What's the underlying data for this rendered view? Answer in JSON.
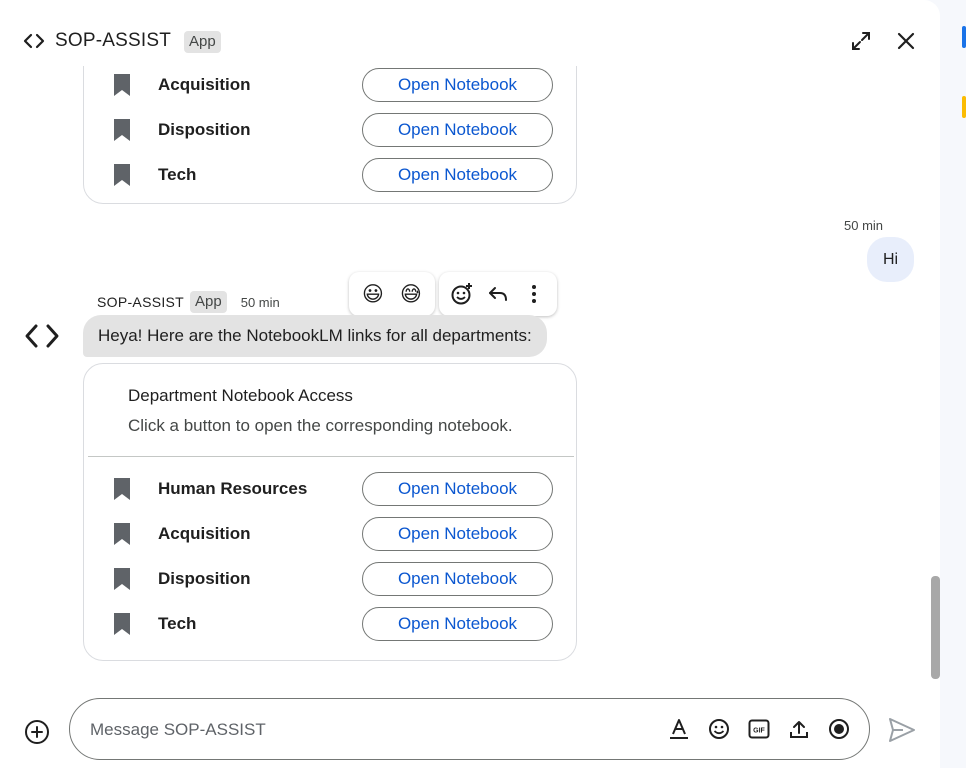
{
  "header": {
    "title": "SOP-ASSIST",
    "badge": "App",
    "icons": {
      "logo": "code-brackets-icon",
      "expand": "expand-icon",
      "close": "close-icon"
    }
  },
  "previous_card": {
    "rows": [
      {
        "label": "Acquisition",
        "button": "Open Notebook"
      },
      {
        "label": "Disposition",
        "button": "Open Notebook"
      },
      {
        "label": "Tech",
        "button": "Open Notebook"
      }
    ]
  },
  "user_message": {
    "time": "50 min",
    "text": "Hi"
  },
  "bot_message": {
    "sender": "SOP-ASSIST",
    "badge": "App",
    "time": "50 min",
    "text": "Heya! Here are the NotebookLM links for all departments:",
    "reactions": [
      "😃",
      "😅"
    ],
    "card": {
      "title": "Department Notebook Access",
      "subtitle": "Click a button to open the corresponding notebook.",
      "rows": [
        {
          "label": "Human Resources",
          "button": "Open Notebook"
        },
        {
          "label": "Acquisition",
          "button": "Open Notebook"
        },
        {
          "label": "Disposition",
          "button": "Open Notebook"
        },
        {
          "label": "Tech",
          "button": "Open Notebook"
        }
      ]
    }
  },
  "composer": {
    "placeholder": "Message SOP-ASSIST",
    "tools": [
      "format-text-icon",
      "emoji-icon",
      "gif-icon",
      "upload-icon",
      "record-icon"
    ],
    "gif_label": "GIF"
  },
  "colors": {
    "accent": "#0b57d0",
    "bubble_user": "#e8eefb",
    "bubble_bot": "#e3e3e3"
  }
}
